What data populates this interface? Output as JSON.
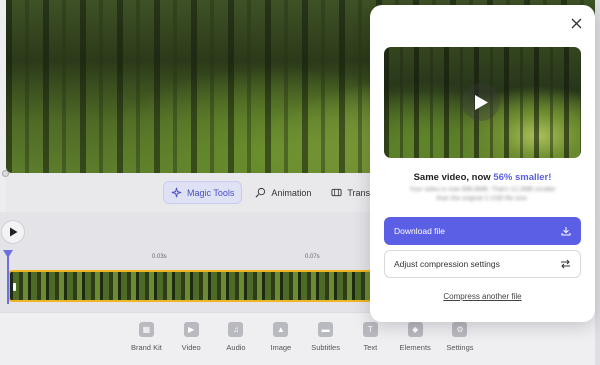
{
  "toolbar": {
    "tabs": [
      {
        "label": "Magic Tools",
        "icon": "sparkle-icon",
        "active": true
      },
      {
        "label": "Animation",
        "icon": "animation-icon",
        "active": false
      },
      {
        "label": "Transitions",
        "icon": "transitions-icon",
        "active": false
      }
    ]
  },
  "timeline": {
    "ruler": [
      "0.03s",
      "0.07s"
    ]
  },
  "bottom_nav": [
    {
      "label": "Brand Kit",
      "icon": "brand-kit-icon"
    },
    {
      "label": "Video",
      "icon": "video-icon"
    },
    {
      "label": "Audio",
      "icon": "audio-icon"
    },
    {
      "label": "Image",
      "icon": "image-icon"
    },
    {
      "label": "Subtitles",
      "icon": "subtitles-icon"
    },
    {
      "label": "Text",
      "icon": "text-icon"
    },
    {
      "label": "Elements",
      "icon": "elements-icon"
    },
    {
      "label": "Settings",
      "icon": "settings-icon"
    }
  ],
  "modal": {
    "headline_prefix": "Same video, now ",
    "headline_accent": "56% smaller!",
    "blurred_line1": "Your video is now 886.8MB. That's 12.2MB smaller",
    "blurred_line2": "than the original 2.1GB file size.",
    "download_label": "Download file",
    "adjust_label": "Adjust compression settings",
    "compress_link": "Compress another file"
  },
  "colors": {
    "accent": "#5b5fe6",
    "clip_border": "#f0b323",
    "playhead": "#6b6fe0"
  }
}
